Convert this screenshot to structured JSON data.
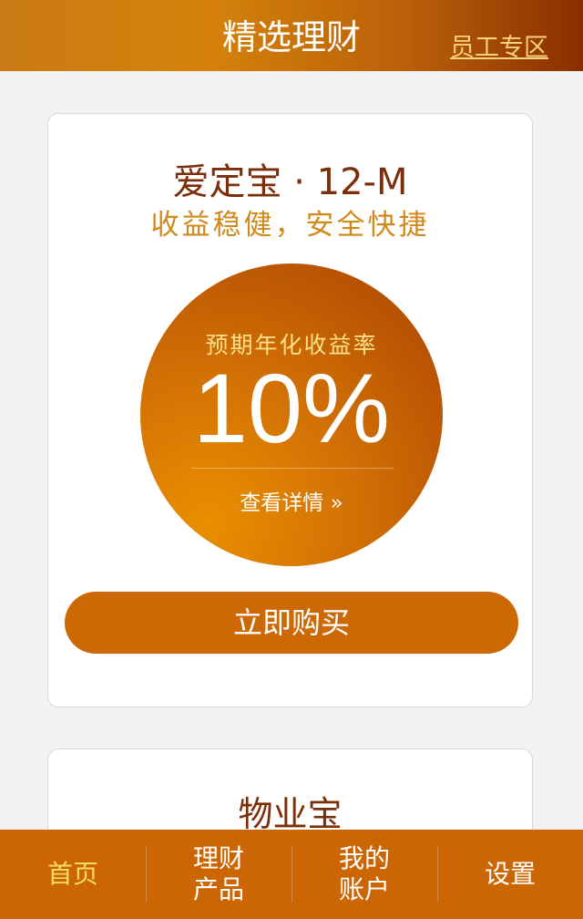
{
  "header": {
    "title": "精选理财",
    "staff_link": "员工专区"
  },
  "products": [
    {
      "name": "爱定宝 · 12-M",
      "slogan": "收益稳健，安全快捷",
      "rate_label": "预期年化收益率",
      "rate_value": "10%",
      "detail_link": "查看详情 »",
      "buy_button": "立即购买"
    },
    {
      "name": "物业宝"
    }
  ],
  "nav": {
    "items": [
      {
        "label": "首页",
        "active": true
      },
      {
        "label": "理财产品",
        "active": false
      },
      {
        "label": "我的账户",
        "active": false
      },
      {
        "label": "设置",
        "active": false
      }
    ]
  },
  "colors": {
    "accent": "#cc6604",
    "title": "#7a2f0a",
    "subtitle": "#d08a1c",
    "active_nav": "#f8db62"
  }
}
